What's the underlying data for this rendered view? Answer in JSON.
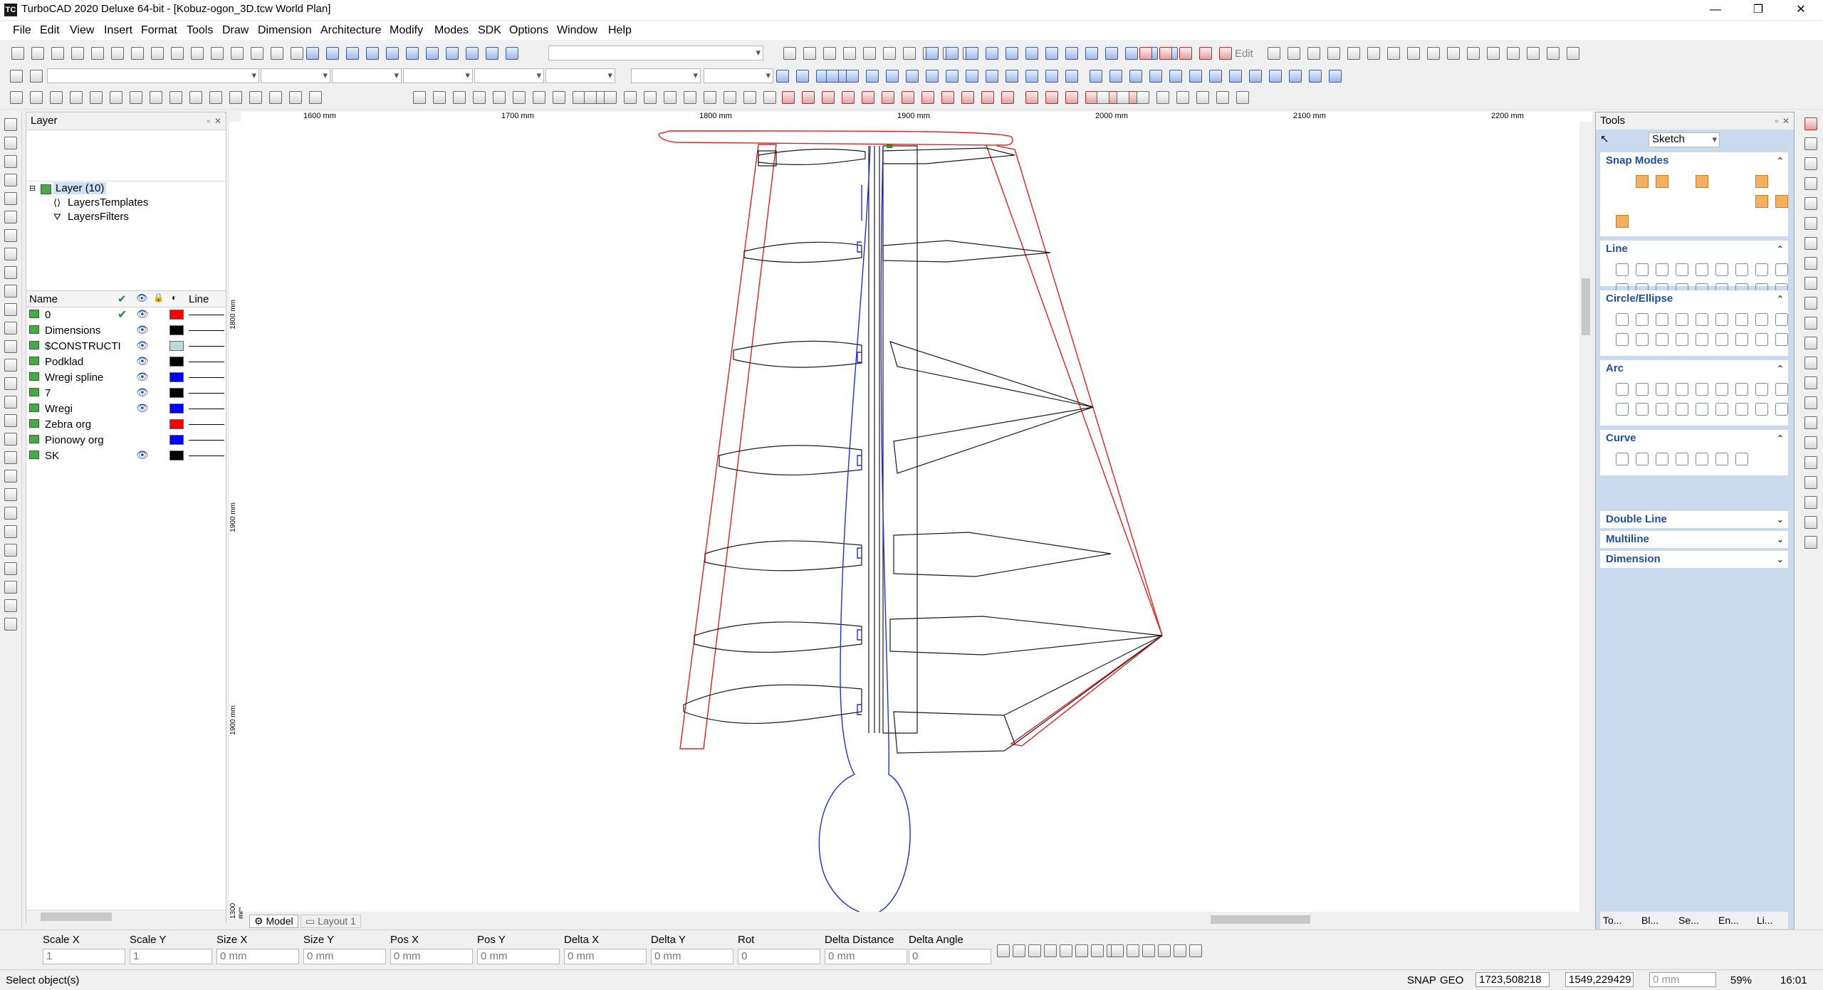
{
  "window": {
    "app_icon": "TC",
    "title": "TurboCAD 2020 Deluxe 64-bit - [Kobuz-ogon_3D.tcw World Plan]",
    "controls": [
      "—",
      "❐",
      "✕"
    ]
  },
  "menu": [
    "File",
    "Edit",
    "View",
    "Insert",
    "Format",
    "Tools",
    "Draw",
    "Dimension",
    "Architecture",
    "Modify",
    "Modes",
    "SDK",
    "Options",
    "Window",
    "Help"
  ],
  "toolbar": {
    "edit_label": "Edit"
  },
  "layer_panel": {
    "title": "Layer",
    "tree": {
      "root": "Layer (10)",
      "children": [
        "LayersTemplates",
        "LayersFilters"
      ]
    },
    "columns": {
      "name": "Name",
      "line": "Line"
    },
    "layers": [
      {
        "name": "0",
        "color": "#ff0000",
        "visible": true,
        "current": true
      },
      {
        "name": "Dimensions",
        "color": "#000000",
        "visible": true,
        "current": false
      },
      {
        "name": "$CONSTRUCTI",
        "color": "#c0d8e0",
        "visible": true,
        "current": false
      },
      {
        "name": "Podklad",
        "color": "#000000",
        "visible": true,
        "current": false
      },
      {
        "name": "Wregi spline",
        "color": "#0000ff",
        "visible": true,
        "current": false
      },
      {
        "name": "7",
        "color": "#000000",
        "visible": true,
        "current": false
      },
      {
        "name": "Wregi",
        "color": "#0000ff",
        "visible": true,
        "current": false
      },
      {
        "name": "Zebra org",
        "color": "#ff0000",
        "visible": false,
        "current": false
      },
      {
        "name": "Pionowy org",
        "color": "#0000ff",
        "visible": false,
        "current": false
      },
      {
        "name": "SK",
        "color": "#000000",
        "visible": true,
        "current": false
      }
    ]
  },
  "rulers": {
    "top": [
      "1600 mm",
      "1700 mm",
      "1800 mm",
      "1900 mm",
      "2000 mm",
      "2100 mm",
      "2200 mm"
    ],
    "left": [
      "1800 mm",
      "1900 mm",
      "1900 mm",
      "1300 mm"
    ]
  },
  "tabs": {
    "model": "Model",
    "layout": "Layout 1"
  },
  "tools_panel": {
    "title": "Tools",
    "mode": "Sketch",
    "sections": [
      {
        "name": "Snap Modes",
        "expanded": true
      },
      {
        "name": "Line",
        "expanded": true
      },
      {
        "name": "Circle/Ellipse",
        "expanded": true
      },
      {
        "name": "Arc",
        "expanded": true
      },
      {
        "name": "Curve",
        "expanded": true
      },
      {
        "name": "Double Line",
        "expanded": false
      },
      {
        "name": "Multiline",
        "expanded": false
      },
      {
        "name": "Dimension",
        "expanded": false
      }
    ],
    "bottom_tabs": [
      "To...",
      "Bl...",
      "Se...",
      "En...",
      "Li..."
    ]
  },
  "inspector": {
    "fields": [
      {
        "label": "Scale X",
        "value": "1"
      },
      {
        "label": "Scale Y",
        "value": "1"
      },
      {
        "label": "Size X",
        "value": "0 mm"
      },
      {
        "label": "Size Y",
        "value": "0 mm"
      },
      {
        "label": "Pos X",
        "value": "0 mm"
      },
      {
        "label": "Pos Y",
        "value": "0 mm"
      },
      {
        "label": "Delta X",
        "value": "0 mm"
      },
      {
        "label": "Delta Y",
        "value": "0 mm"
      },
      {
        "label": "Rot",
        "value": "0"
      },
      {
        "label": "Delta Distance",
        "value": "0 mm"
      },
      {
        "label": "Delta Angle",
        "value": "0"
      }
    ]
  },
  "status": {
    "prompt": "Select object(s)",
    "snap": "SNAP",
    "geo": "GEO",
    "x": "1723,508218",
    "y": "1549,229429",
    "z": "0 mm",
    "zoom": "59%",
    "time": "16:01"
  }
}
